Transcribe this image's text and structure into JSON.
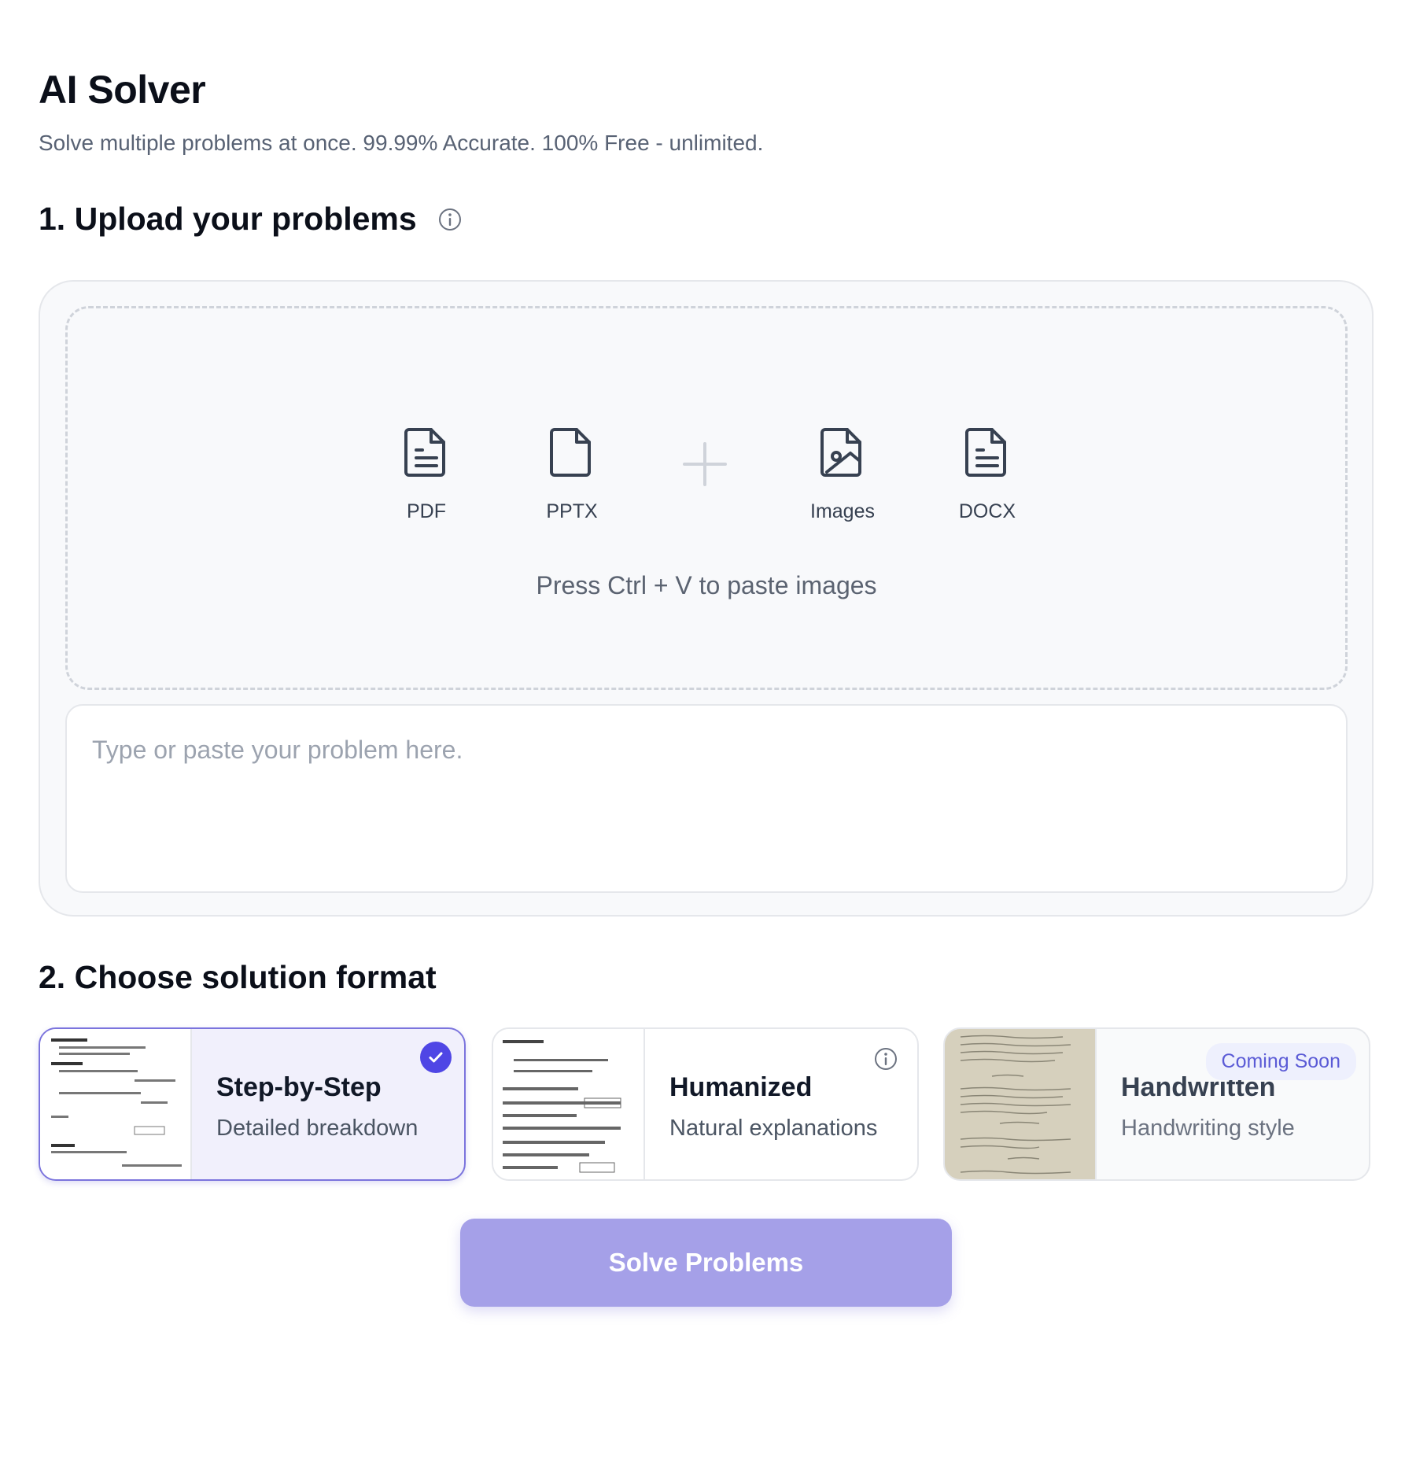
{
  "header": {
    "title": "AI Solver",
    "subtitle": "Solve multiple problems at once. 99.99% Accurate. 100% Free - unlimited."
  },
  "upload": {
    "heading": "1. Upload your problems",
    "info_icon": "info-icon",
    "filetypes": [
      {
        "label": "PDF",
        "icon": "pdf-file-icon"
      },
      {
        "label": "PPTX",
        "icon": "pptx-file-icon"
      },
      {
        "label": "Images",
        "icon": "image-file-icon"
      },
      {
        "label": "DOCX",
        "icon": "docx-file-icon"
      }
    ],
    "plus_icon": "plus-icon",
    "paste_hint": "Press Ctrl + V to paste images",
    "input_placeholder": "Type or paste your problem here.",
    "input_value": ""
  },
  "format": {
    "heading": "2. Choose solution format",
    "options": [
      {
        "title": "Step-by-Step",
        "description": "Detailed breakdown",
        "selected": true
      },
      {
        "title": "Humanized",
        "description": "Natural explanations",
        "selected": false
      },
      {
        "title": "Handwritten",
        "description": "Handwriting style",
        "selected": false,
        "badge": "Coming Soon"
      }
    ]
  },
  "actions": {
    "solve_label": "Solve Problems"
  },
  "colors": {
    "accent": "#4f46e5",
    "button_disabled": "#a5a0e8",
    "selected_card_bg": "#f1f0fc"
  }
}
